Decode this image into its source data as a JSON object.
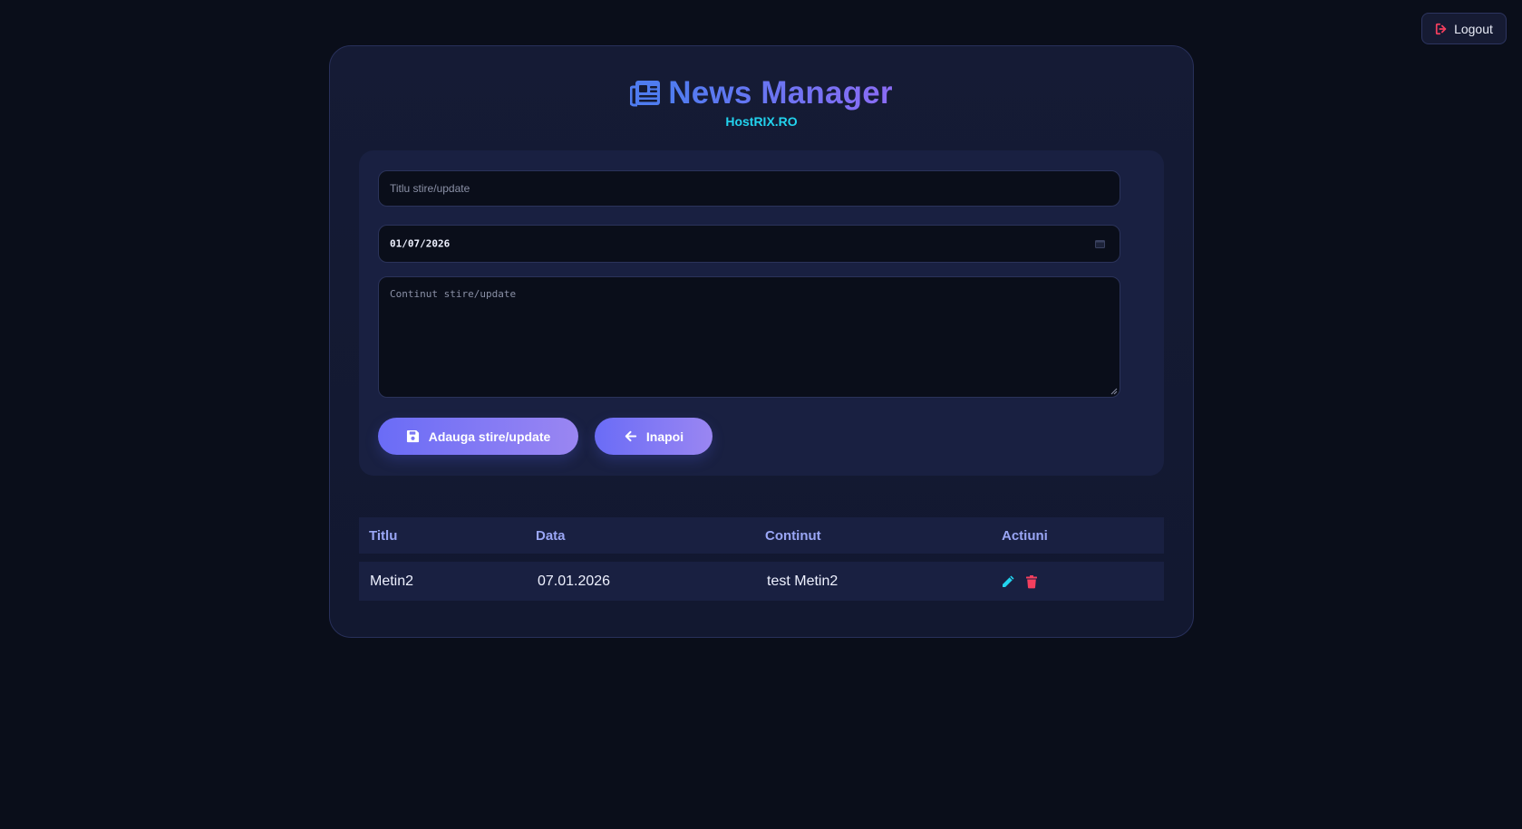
{
  "topbar": {
    "logout_label": "Logout"
  },
  "header": {
    "title": "News Manager",
    "subtitle": "HostRIX.RO",
    "icon": "newspaper-icon"
  },
  "form": {
    "title_placeholder": "Titlu stire/update",
    "date_value": "01/07/2026",
    "content_placeholder": "Continut stire/update",
    "save_label": "Adauga stire/update",
    "back_label": "Inapoi"
  },
  "table": {
    "headers": [
      "Titlu",
      "Data",
      "Continut",
      "Actiuni"
    ],
    "rows": [
      {
        "title": "Metin2",
        "date": "07.01.2026",
        "content": "test Metin2"
      }
    ]
  },
  "colors": {
    "background": "#0a0e1a",
    "accent_gradient_start": "#6a6cf6",
    "accent_gradient_end": "#9a86f2",
    "subtitle": "#22d3ee",
    "edit_icon": "#22d3ee",
    "delete_icon": "#f43f5e",
    "logout_icon": "#f43f5e"
  }
}
